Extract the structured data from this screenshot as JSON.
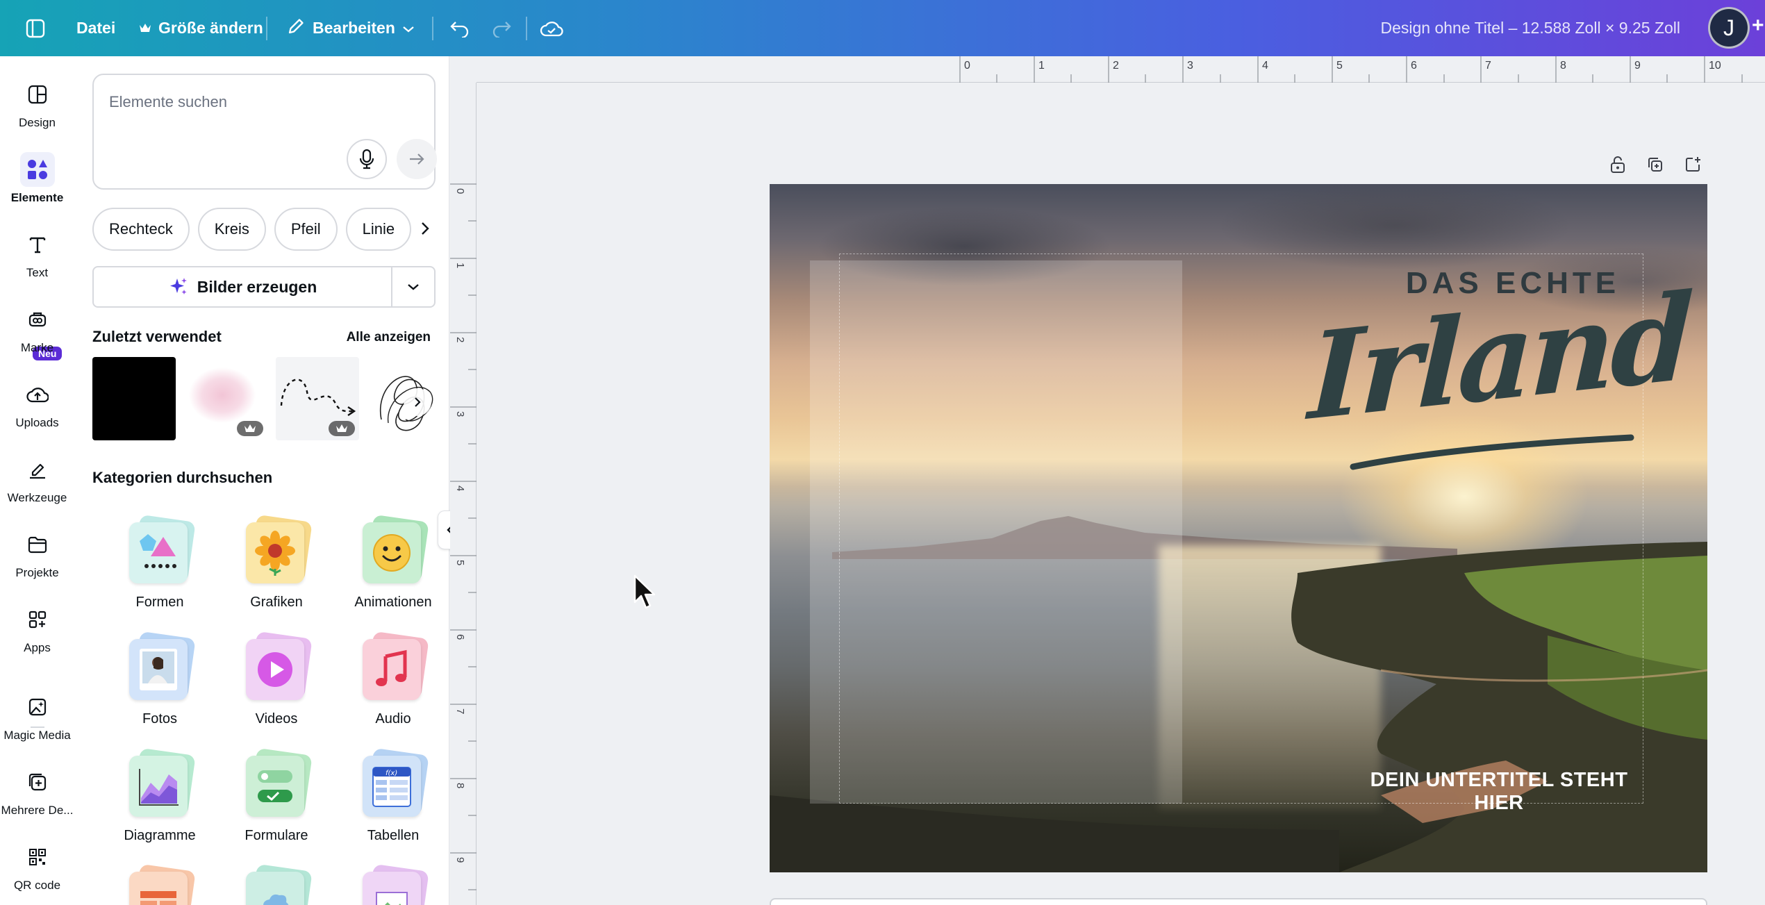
{
  "topbar": {
    "file": "Datei",
    "resize": "Größe ändern",
    "edit": "Bearbeiten",
    "doc_title": "Design ohne Titel – 12.588 Zoll × 9.25 Zoll",
    "avatar_initial": "J",
    "plus": "+"
  },
  "rail": {
    "items": [
      {
        "label": "Design",
        "icon": "layout-icon"
      },
      {
        "label": "Elemente",
        "icon": "shapes-icon"
      },
      {
        "label": "Text",
        "icon": "text-icon"
      },
      {
        "label": "Marke",
        "icon": "brand-icon"
      },
      {
        "label": "Uploads",
        "icon": "cloud-upload-icon"
      },
      {
        "label": "Werkzeuge",
        "icon": "pen-tool-icon"
      },
      {
        "label": "Projekte",
        "icon": "folder-icon"
      },
      {
        "label": "Apps",
        "icon": "apps-grid-icon"
      },
      {
        "label": "Magic Media",
        "icon": "magic-media-icon"
      },
      {
        "label": "Mehrere De...",
        "icon": "multi-design-icon"
      },
      {
        "label": "QR code",
        "icon": "qr-code-icon"
      }
    ],
    "badge_new": "Neu"
  },
  "panel": {
    "search_placeholder": "Elemente suchen",
    "chips": [
      "Rechteck",
      "Kreis",
      "Pfeil",
      "Linie"
    ],
    "generate_label": "Bilder erzeugen",
    "recent_title": "Zuletzt verwendet",
    "see_all": "Alle anzeigen",
    "categories_title": "Kategorien durchsuchen",
    "categories": [
      {
        "label": "Formen",
        "icon": "shapes-category-icon"
      },
      {
        "label": "Grafiken",
        "icon": "sunflower-icon"
      },
      {
        "label": "Animationen",
        "icon": "smiley-icon"
      },
      {
        "label": "Fotos",
        "icon": "photo-icon"
      },
      {
        "label": "Videos",
        "icon": "play-icon"
      },
      {
        "label": "Audio",
        "icon": "music-note-icon"
      },
      {
        "label": "Diagramme",
        "icon": "chart-icon"
      },
      {
        "label": "Formulare",
        "icon": "form-icon"
      },
      {
        "label": "Tabellen",
        "icon": "table-icon"
      }
    ]
  },
  "ruler": {
    "top": [
      "0",
      "1",
      "2",
      "3",
      "4",
      "5",
      "6",
      "7",
      "8",
      "9",
      "10"
    ],
    "left": [
      "0",
      "1",
      "2",
      "3",
      "4",
      "5",
      "6",
      "7",
      "8",
      "9"
    ]
  },
  "design": {
    "headline_small": "DAS ECHTE",
    "headline_big": "Irland",
    "subtitle": "DEIN UNTERTITEL STEHT HIER"
  },
  "colors": {
    "accent": "#7d2ae8",
    "topbar_start": "#16a3b6",
    "topbar_end": "#6c40d9"
  }
}
